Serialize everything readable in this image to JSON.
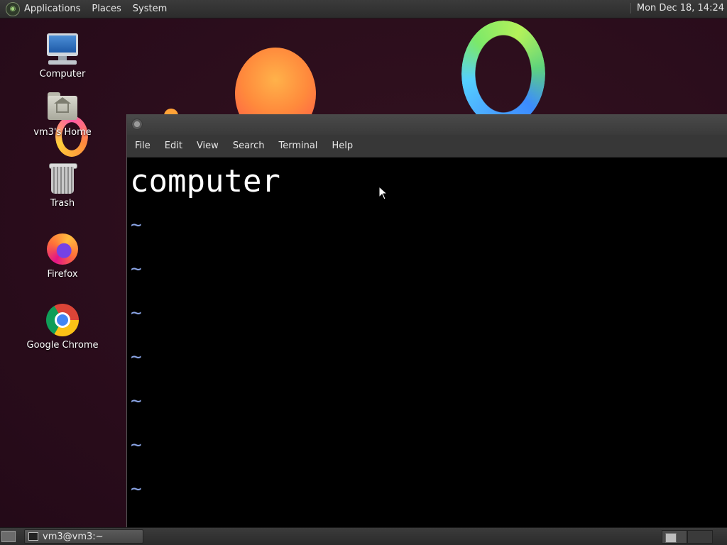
{
  "top_panel": {
    "menus": [
      "Applications",
      "Places",
      "System"
    ],
    "clock": "Mon Dec 18, 14:24"
  },
  "desktop_icons": [
    {
      "label": "Computer",
      "icon": "computer-icon"
    },
    {
      "label": "vm3's Home",
      "icon": "home-folder-icon"
    },
    {
      "label": "Trash",
      "icon": "trash-icon"
    },
    {
      "label": "Firefox",
      "icon": "firefox-icon"
    },
    {
      "label": "Google Chrome",
      "icon": "chrome-icon"
    }
  ],
  "terminal": {
    "menu": [
      "File",
      "Edit",
      "View",
      "Search",
      "Terminal",
      "Help"
    ],
    "content_line": "computer",
    "tilde": "~"
  },
  "bottom_panel": {
    "task_label": "vm3@vm3:~"
  },
  "colors": {
    "tilde": "#8ba5e6",
    "terminal_bg": "#000000",
    "panel_bg": "#2c2c2c"
  }
}
